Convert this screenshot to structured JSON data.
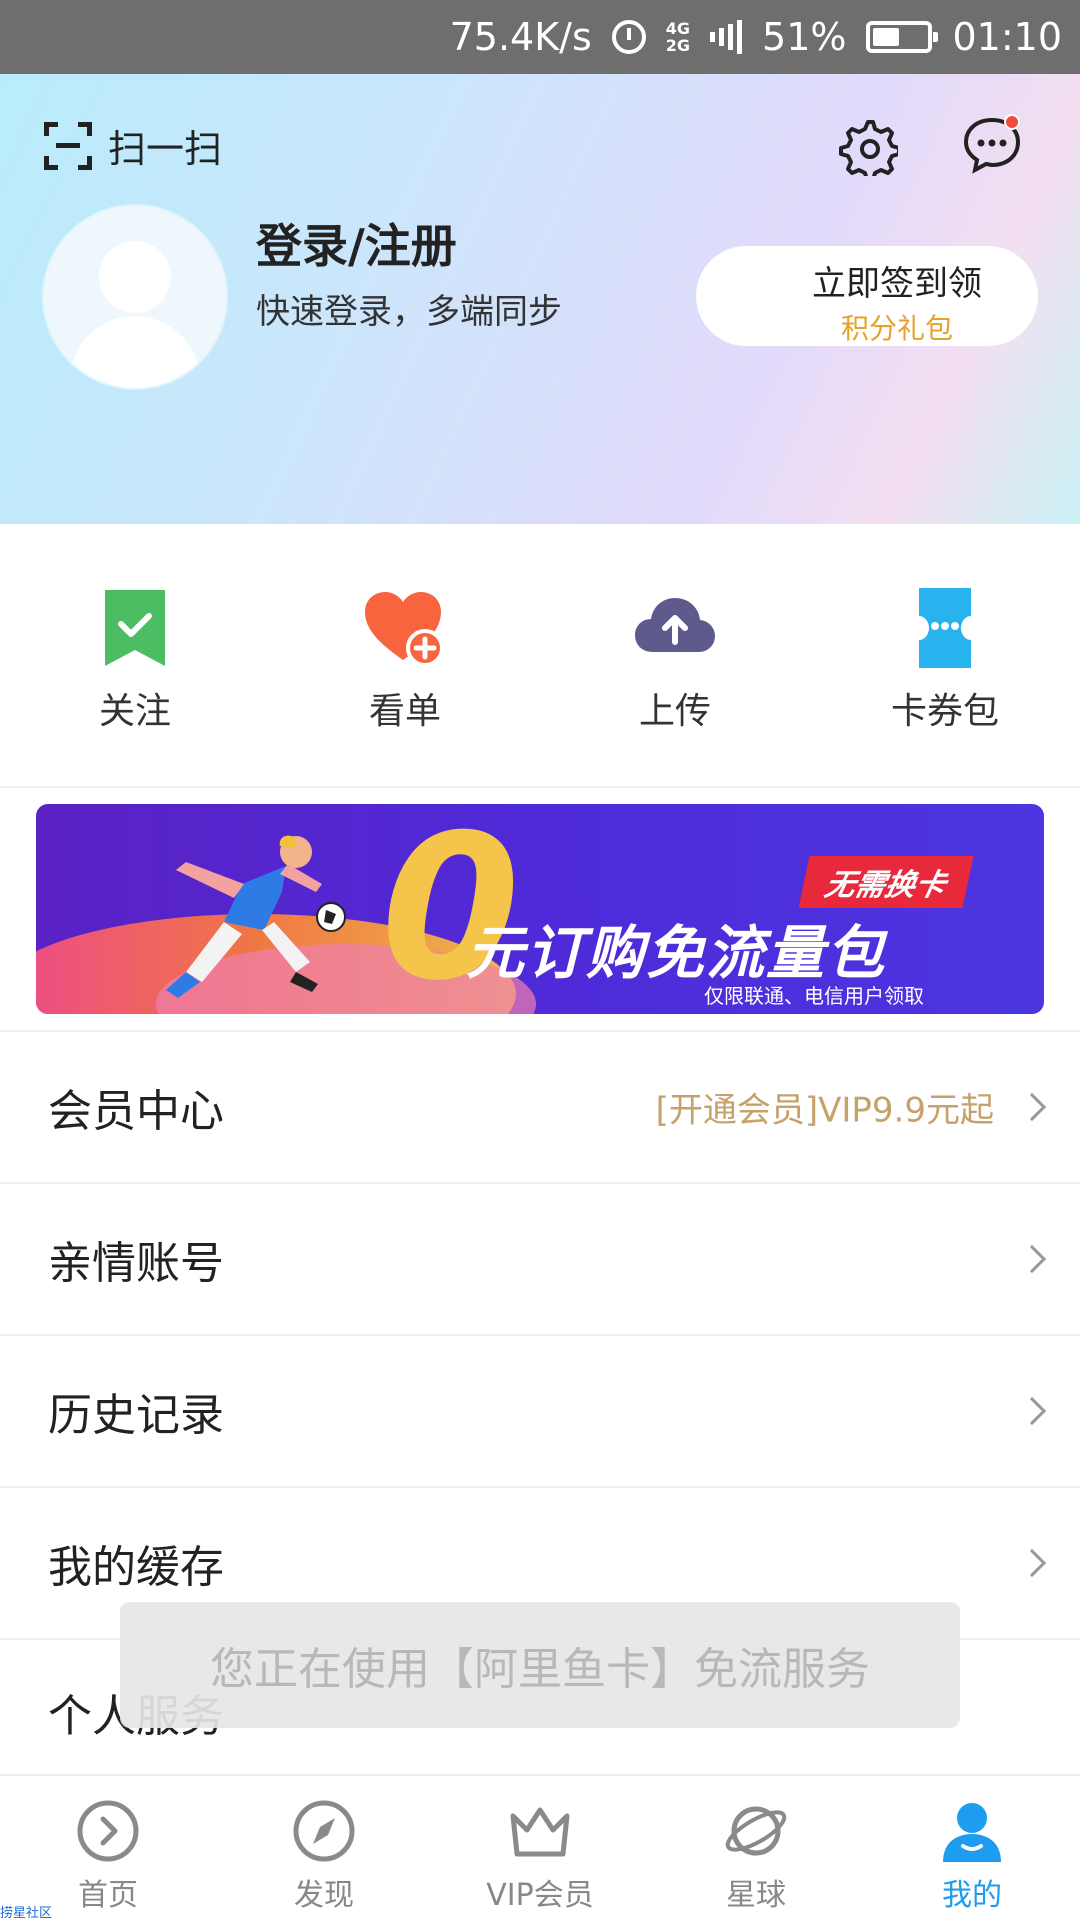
{
  "status_bar": {
    "speed": "75.4K/s",
    "net_top": "4G",
    "net_bottom": "2G",
    "battery": "51%",
    "time": "01:10"
  },
  "header": {
    "scan_label": "扫一扫",
    "login_title": "登录/注册",
    "login_subtitle": "快速登录，多端同步",
    "checkin_line1": "立即签到领",
    "checkin_line2": "积分礼包"
  },
  "quick_actions": [
    {
      "label": "关注",
      "icon": "bookmark-check-icon"
    },
    {
      "label": "看单",
      "icon": "heart-plus-icon"
    },
    {
      "label": "上传",
      "icon": "cloud-upload-icon"
    },
    {
      "label": "卡券包",
      "icon": "ticket-icon"
    }
  ],
  "banner": {
    "big_digit": "0",
    "tag": "无需换卡",
    "headline": "元订购免流量包",
    "fine_print": "仅限联通、电信用户领取"
  },
  "menu": [
    {
      "label": "会员中心",
      "value": "[开通会员]VIP9.9元起"
    },
    {
      "label": "亲情账号",
      "value": ""
    },
    {
      "label": "历史记录",
      "value": ""
    },
    {
      "label": "我的缓存",
      "value": ""
    },
    {
      "label": "个人服务",
      "value": ""
    }
  ],
  "toast": "您正在使用【阿里鱼卡】免流服务",
  "bottom_nav": [
    {
      "label": "首页",
      "icon": "play-circle-icon"
    },
    {
      "label": "发现",
      "icon": "compass-icon"
    },
    {
      "label": "VIP会员",
      "icon": "crown-icon"
    },
    {
      "label": "星球",
      "icon": "planet-icon"
    },
    {
      "label": "我的",
      "icon": "user-icon",
      "active": true
    }
  ],
  "watermark": "捞星社区",
  "colors": {
    "accent": "#1e9cf0",
    "gold": "#c6a26a",
    "checkin_orange": "#e6a12a",
    "follow_green": "#4cbd62",
    "heart_orange": "#f7643e",
    "cloud_purple": "#5f5a8c",
    "ticket_blue": "#28b3ef"
  }
}
